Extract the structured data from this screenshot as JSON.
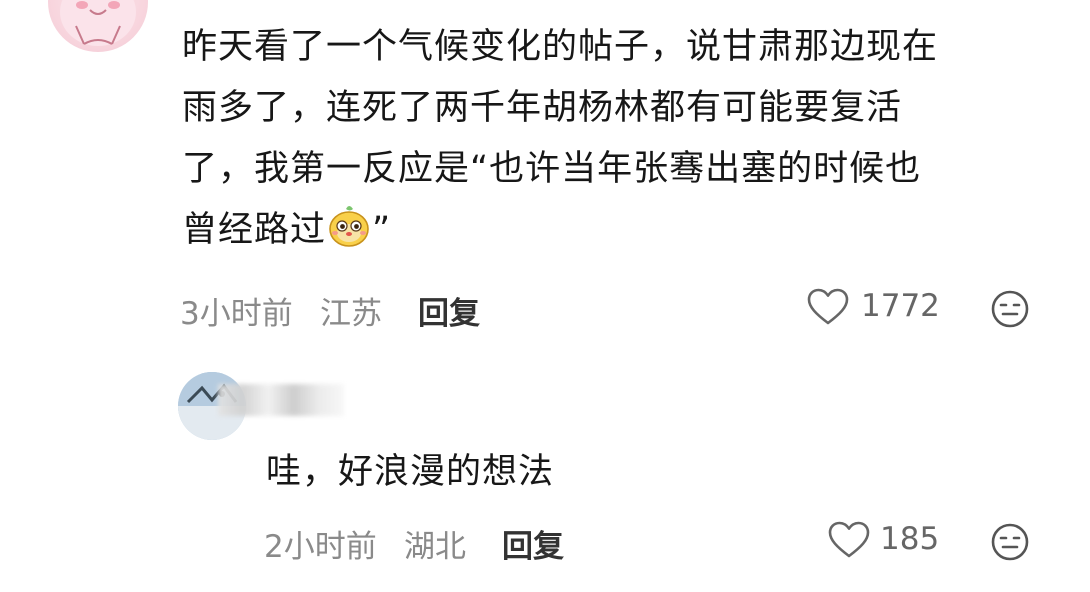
{
  "comment": {
    "text_lines": [
      "昨天看了一个气候变化的帖子，说甘肃那边现在",
      "雨多了，连死了两千年胡杨林都有可能要复活",
      "了，我第一反应是“也许当年张骞出塞的时候也",
      "曾经路过"
    ],
    "text_end": "”",
    "sticker_icon": "cute-face-sticker",
    "time": "3小时前",
    "location": "江苏",
    "reply_label": "回复",
    "likes": "1772",
    "heart_icon": "heart-outline-icon",
    "emoji_icon": "neutral-face-icon"
  },
  "reply": {
    "text": "哇，好浪漫的想法",
    "time": "2小时前",
    "location": "湖北",
    "reply_label": "回复",
    "likes": "185",
    "heart_icon": "heart-outline-icon",
    "emoji_icon": "neutral-face-icon"
  }
}
